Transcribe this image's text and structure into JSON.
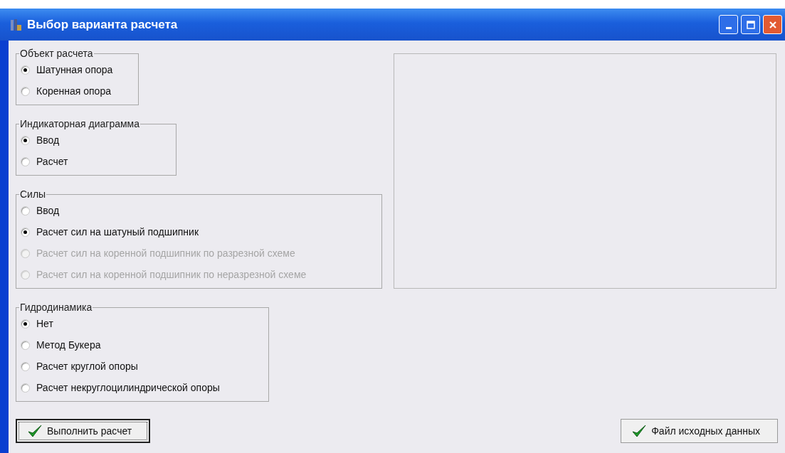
{
  "window": {
    "title": "Выбор варианта расчета"
  },
  "groups": [
    {
      "title": "Объект расчета",
      "options": [
        {
          "label": "Шатунная опора",
          "selected": true,
          "disabled": false
        },
        {
          "label": "Коренная опора",
          "selected": false,
          "disabled": false
        }
      ]
    },
    {
      "title": "Индикаторная диаграмма",
      "options": [
        {
          "label": "Ввод",
          "selected": true,
          "disabled": false
        },
        {
          "label": "Расчет",
          "selected": false,
          "disabled": false
        }
      ]
    },
    {
      "title": "Силы",
      "options": [
        {
          "label": "Ввод",
          "selected": false,
          "disabled": false
        },
        {
          "label": "Расчет сил на шатуный подшипник",
          "selected": true,
          "disabled": false
        },
        {
          "label": "Расчет сил на коренной подшипник по разрезной схеме",
          "selected": false,
          "disabled": true
        },
        {
          "label": "Расчет сил на коренной подшипник по неразрезной схеме",
          "selected": false,
          "disabled": true
        }
      ]
    },
    {
      "title": "Гидродинамика",
      "options": [
        {
          "label": "Нет",
          "selected": true,
          "disabled": false
        },
        {
          "label": "Метод Букера",
          "selected": false,
          "disabled": false
        },
        {
          "label": "Расчет круглой опоры",
          "selected": false,
          "disabled": false
        },
        {
          "label": "Расчет некруглоцилиндрической опоры",
          "selected": false,
          "disabled": false
        }
      ]
    }
  ],
  "buttons": [
    {
      "label": "Выполнить расчет",
      "focused": true
    },
    {
      "label": "Файл исходных данных",
      "focused": false
    }
  ]
}
